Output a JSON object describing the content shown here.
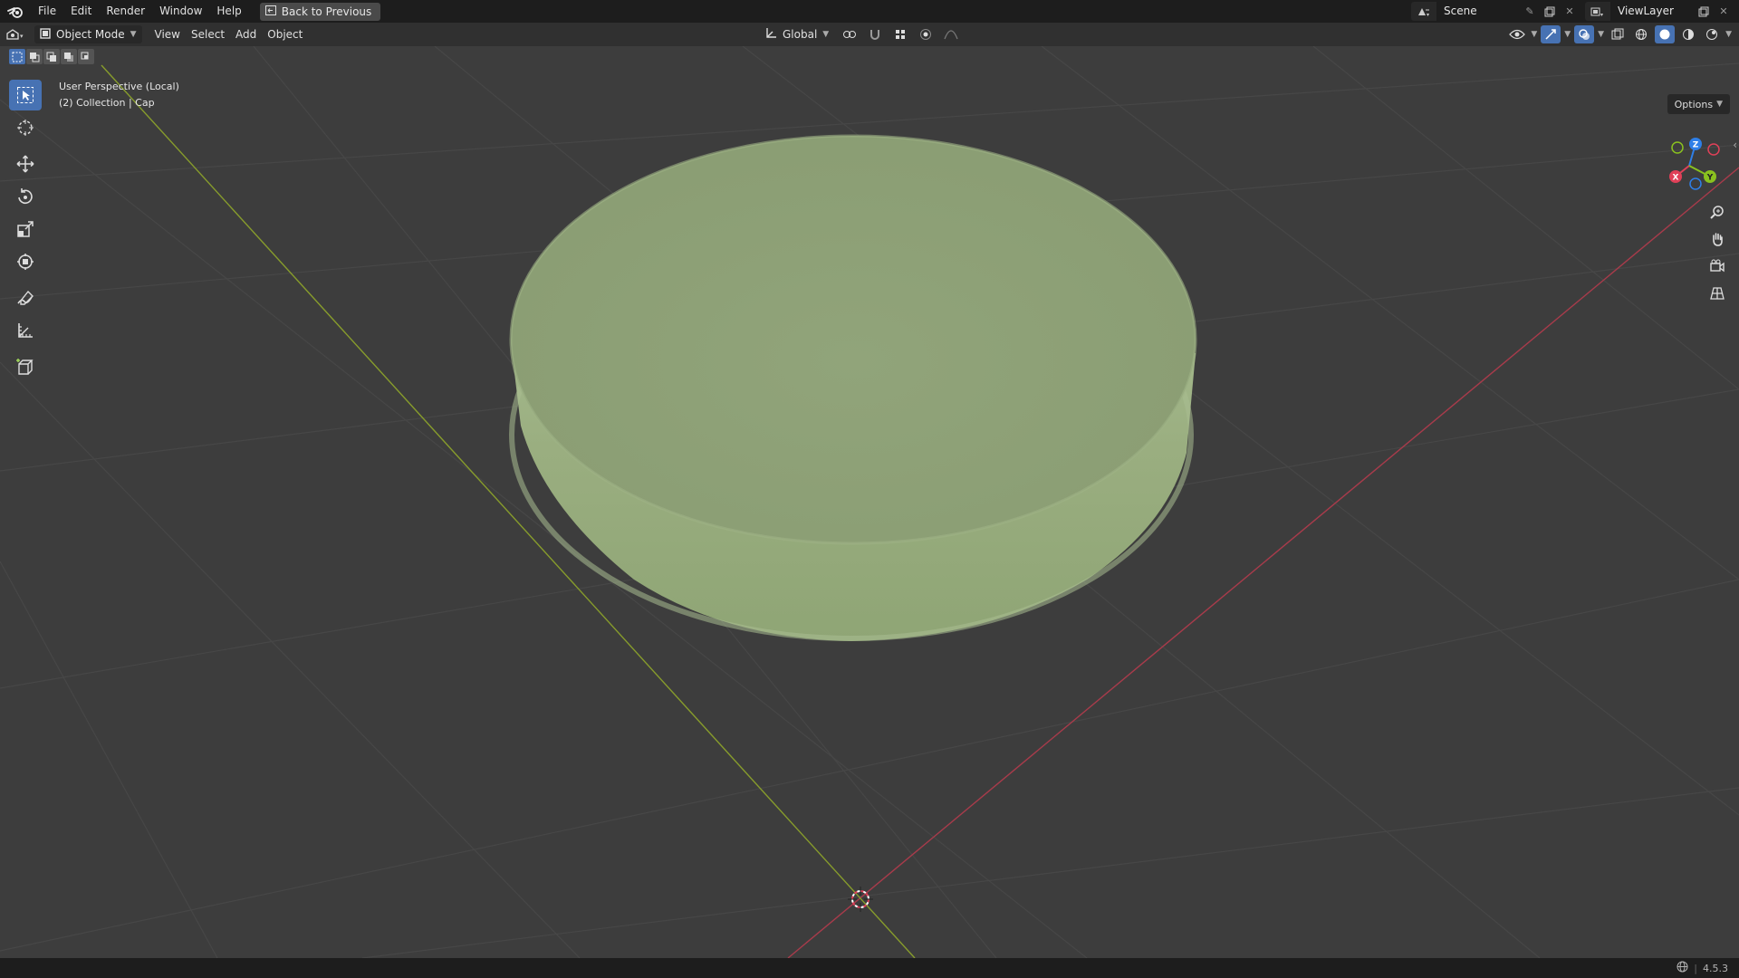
{
  "menu": {
    "items": [
      "File",
      "Edit",
      "Render",
      "Window",
      "Help"
    ],
    "back_button": "Back to Previous"
  },
  "scene": {
    "name": "Scene"
  },
  "view_layer": {
    "name": "ViewLayer"
  },
  "viewport_header": {
    "mode": "Object Mode",
    "menus": [
      "View",
      "Select",
      "Add",
      "Object"
    ],
    "transform_orientation": "Global"
  },
  "viewport": {
    "view_name": "User Perspective (Local)",
    "collection_info": "(2) Collection | Cap",
    "options_label": "Options",
    "object_color": "#93a579",
    "x_axis_color": "#a83b4b",
    "y_axis_color": "#879c2c"
  },
  "gizmo": {
    "z_label": "Z",
    "x_label": "X",
    "y_label": "Y",
    "z_color": "#2e7fe8",
    "x_color": "#e04058",
    "y_color": "#8ac21f"
  },
  "status": {
    "version": "4.5.3"
  }
}
